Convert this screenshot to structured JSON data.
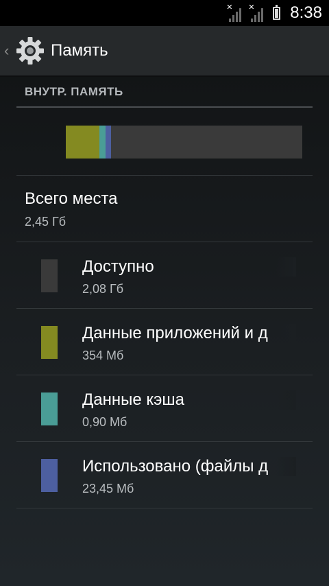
{
  "status_bar": {
    "time": "8:38",
    "icons": [
      "signal-icon",
      "signal-icon",
      "battery-icon"
    ]
  },
  "action_bar": {
    "title": "Память",
    "icon": "gear-icon"
  },
  "storage": {
    "section_header": "ВНУТР. ПАМЯТЬ",
    "usage_colors": {
      "apps": "#848a21",
      "cache": "#4a9d96",
      "misc": "#4d5fa0",
      "available": "#3a3a3a"
    },
    "total": {
      "label": "Всего места",
      "value": "2,45 Гб"
    },
    "items": [
      {
        "label": "Доступно",
        "value": "2,08 Гб",
        "color": "#3a3a3a"
      },
      {
        "label": "Данные приложений и д",
        "value": "354 Мб",
        "color": "#848a21"
      },
      {
        "label": "Данные кэша",
        "value": "0,90 Мб",
        "color": "#4a9d96"
      },
      {
        "label": "Использовано (файлы д",
        "value": "23,45 Мб",
        "color": "#4d5fa0"
      }
    ]
  }
}
